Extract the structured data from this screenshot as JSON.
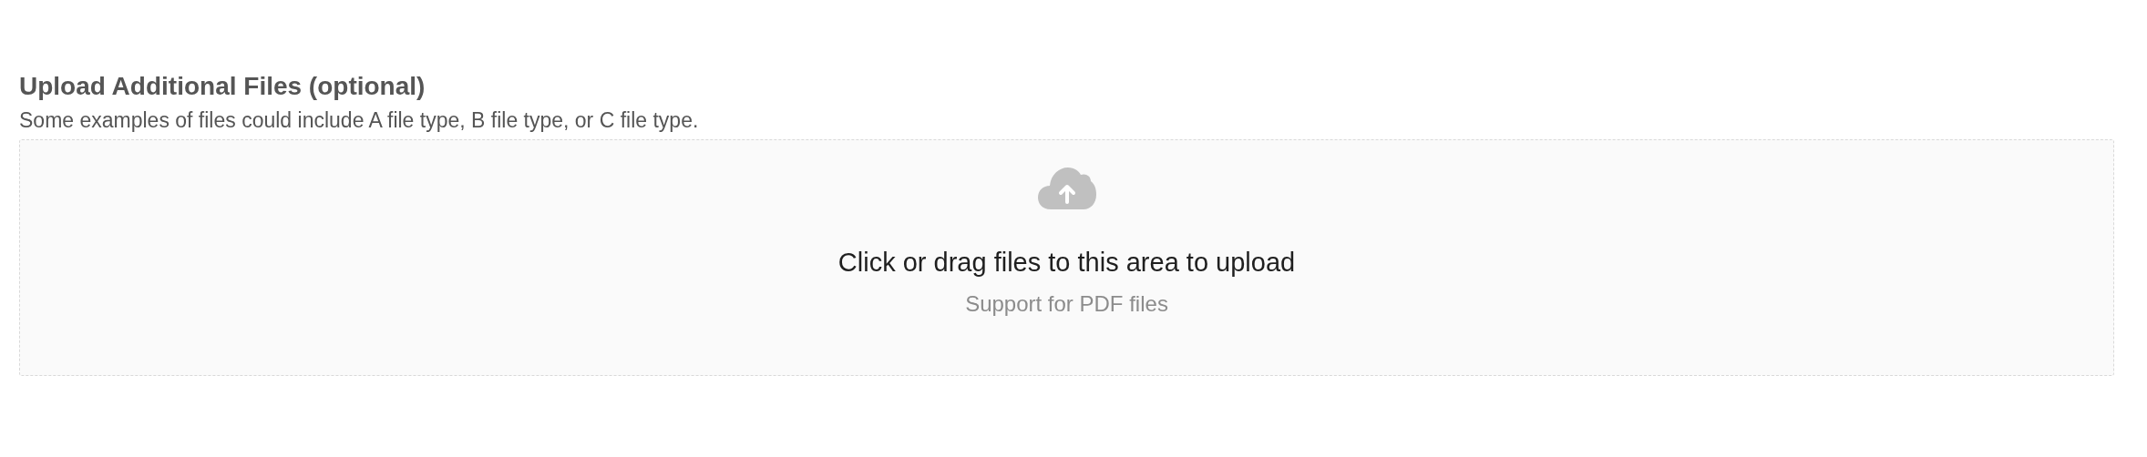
{
  "section": {
    "title": "Upload Additional Files (optional)",
    "description": "Some examples of files could include A file type, B file type, or C file type."
  },
  "dropzone": {
    "text": "Click or drag files to this area to upload",
    "hint": "Support for PDF files"
  }
}
